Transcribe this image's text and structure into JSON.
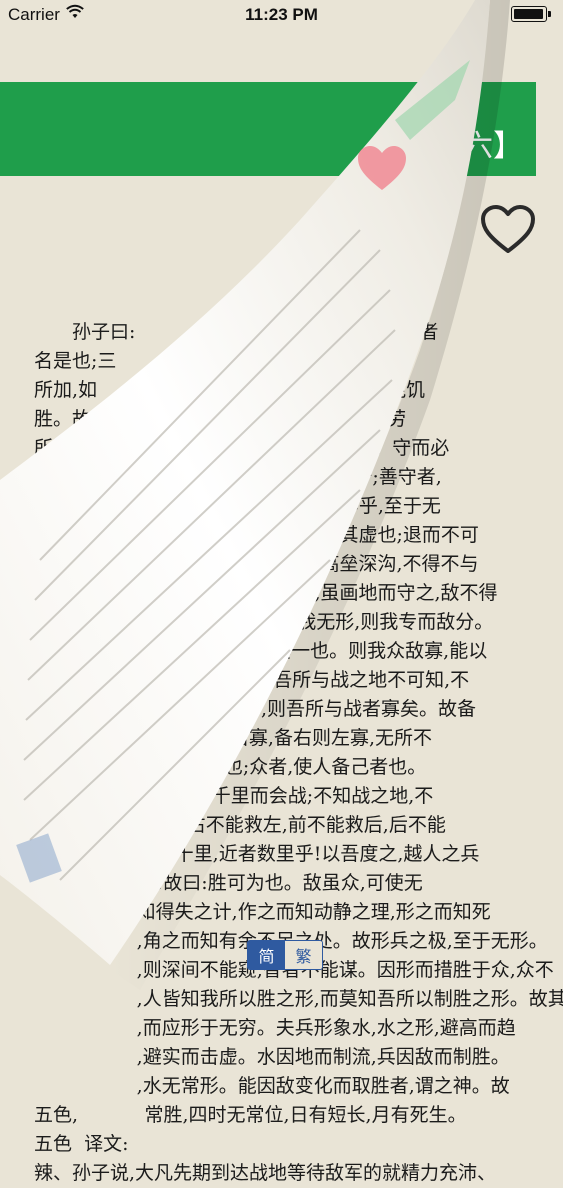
{
  "status_bar": {
    "carrier": "Carrier",
    "time": "11:23 PM",
    "wifi_icon": "wifi-icon",
    "battery_icon": "battery-icon"
  },
  "chapter": {
    "title": "5.   第六】"
  },
  "favorite": {
    "icon": "heart-outline-icon"
  },
  "page_curl": {
    "heart_color": "#f08a94"
  },
  "colors": {
    "banner": "#1f9e4b",
    "page_background": "#e9e4d6",
    "toggle_accent": "#2f5aa0"
  },
  "body_lines": [
    "孙子曰:                         后处战地而趋战者",
    "名是也;三                      使敌人自至者,利之",
    "所加,如                         故敌佚能劳之,饱能饥",
    "胜。故                           意。行千里而不劳",
    "所导                              ,攻其所不守也。守而必",
    "胆                                 ,敌不知其所守;善守者,",
    "                                     无形;神乎神乎,至于无",
    "                                     可御者,冲其虚也;退而不可",
    "                                     故,敌虽高垒深沟,不得不与",
    "                                     不欲战,虽画地而守之,敌不得",
    "                               敌形人而我无形,则我专而敌分。",
    "                              以十攻其一也。则我众敌寡,能以",
    "                           者约矣。吾所与战之地不可知,不",
    "                         所备者多,则吾所与战者寡矣。故备",
    "                      ,备左则右寡,备右则左寡,无所不",
    "                     ,备人者也;众者,使人备己者也。",
    "                   日,则可千里而会战;不知战之地,不",
    "                  救右,右不能救左,前不能救后,后不能",
    "                 者数十里,近者数里乎!以吾度之,越人之兵",
    "                 哉!故曰:胜可为也。敌虽众,可使无",
    "                 知得失之计,作之而知动静之理,形之而知死",
    "                 ,角之而知有余不足之处。故形兵之极,至于无形。",
    "                 ,则深间不能窥,智者不能谋。因形而措胜于众,众不",
    "                 ,人皆知我所以胜之形,而莫知吾所以制胜之形。故其",
    "                 ,而应形于无穷。夫兵形象水,水之形,避高而趋",
    "                 ,避实而击虚。水因地而制流,兵因敌而制胜。",
    "                 ,水无常形。能因敌变化而取胜者,谓之神。故",
    "五色,           常胜,四时无常位,日有短长,月有死生。",
    "五色  译文:",
    "辣、孙子说,大凡先期到达战地等待敌军的就精力充沛、"
  ],
  "script_toggle": {
    "simplified": "简",
    "traditional": "繁"
  }
}
